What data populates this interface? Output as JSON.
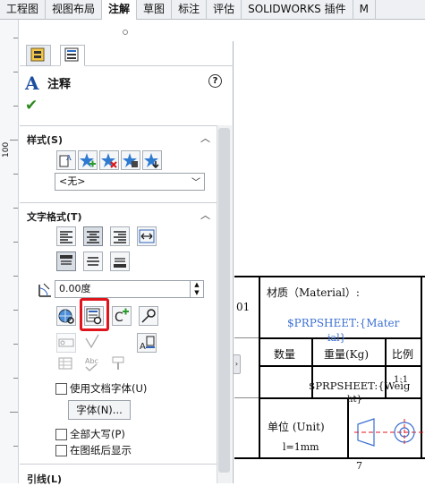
{
  "tabs": [
    "工程图",
    "视图布局",
    "注解",
    "草图",
    "标注",
    "评估",
    "SOLIDWORKS 插件",
    "M"
  ],
  "active_tab": 2,
  "ruler": {
    "label": "100"
  },
  "panel": {
    "title": "注释",
    "help_icon": "help-icon",
    "ok_icon": "checkmark-icon",
    "sections": {
      "style": {
        "title": "样式(S)",
        "select_value": "<无>"
      },
      "text_format": {
        "title": "文字格式(T)",
        "angle_value": "0.00度",
        "checkboxes": {
          "use_doc_font": "使用文档字体(U)",
          "all_caps": "全部大写(P)",
          "show_behind": "在图纸后显示"
        },
        "font_button": "字体(N)..."
      },
      "leader": {
        "title": "引线(L)"
      }
    }
  },
  "title_block": {
    "left_num": "01",
    "material_label": "材质（Material）:",
    "material_prop_1": "$PRPSHEET:{Mater",
    "material_prop_2": "ial}",
    "qty": "数量",
    "weight": "重量(Kg)",
    "scale": "比例",
    "weight_prop_1": "$PRPSHEET:{Weig",
    "weight_prop_2": "ht}",
    "scale_val": "1:1",
    "unit_label": "单位 (Unit)",
    "unit_val": "l=1mm",
    "bottom_num": "7"
  },
  "colors": {
    "accent": "#e0141b",
    "prop_text": "#3a6fd0",
    "ok": "#2c8a1d"
  }
}
